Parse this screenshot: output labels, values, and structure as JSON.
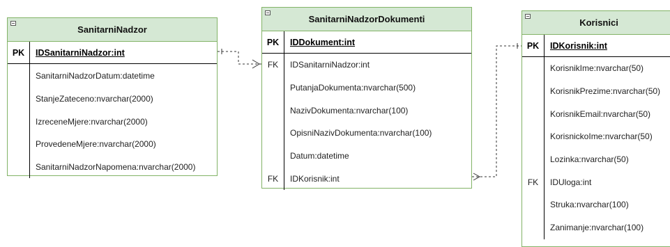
{
  "entities": {
    "sanitarni_nadzor": {
      "title": "SanitarniNadzor",
      "pk_label": "PK",
      "pk_field": "IDSanitarniNadzor:int",
      "attributes": [
        {
          "key": "",
          "field": "SanitarniNadzorDatum:datetime"
        },
        {
          "key": "",
          "field": "StanjeZateceno:nvarchar(2000)"
        },
        {
          "key": "",
          "field": "IzreceneMjere:nvarchar(2000)"
        },
        {
          "key": "",
          "field": "ProvedeneMjere:nvarchar(2000)"
        },
        {
          "key": "",
          "field": "SanitarniNadzorNapomena:nvarchar(2000)"
        }
      ]
    },
    "sanitarni_nadzor_dokumenti": {
      "title": "SanitarniNadzorDokumenti",
      "pk_label": "PK",
      "pk_field": "IDDokument:int",
      "attributes": [
        {
          "key": "FK",
          "field": "IDSanitarniNadzor:int"
        },
        {
          "key": "",
          "field": "PutanjaDokumenta:nvarchar(500)"
        },
        {
          "key": "",
          "field": "NazivDokumenta:nvarchar(100)"
        },
        {
          "key": "",
          "field": "OpisniNazivDokumenta:nvarchar(100)"
        },
        {
          "key": "",
          "field": "Datum:datetime"
        },
        {
          "key": "FK",
          "field": "IDKorisnik:int"
        }
      ]
    },
    "korisnici": {
      "title": "Korisnici",
      "pk_label": "PK",
      "pk_field": "IDKorisnik:int",
      "attributes": [
        {
          "key": "",
          "field": "KorisnikIme:nvarchar(50)"
        },
        {
          "key": "",
          "field": "KorisnikPrezime:nvarchar(50)"
        },
        {
          "key": "",
          "field": "KorisnikEmail:nvarchar(50)"
        },
        {
          "key": "",
          "field": "KorisnickoIme:nvarchar(50)"
        },
        {
          "key": "",
          "field": "Lozinka:nvarchar(50)"
        },
        {
          "key": "FK",
          "field": "IDUloga:int"
        },
        {
          "key": "",
          "field": "Struka:nvarchar(100)"
        },
        {
          "key": "",
          "field": "Zanimanje:nvarchar(100)"
        }
      ]
    }
  },
  "colors": {
    "header_fill": "#d5e8d4",
    "border": "#82b366",
    "connector": "#333333"
  }
}
